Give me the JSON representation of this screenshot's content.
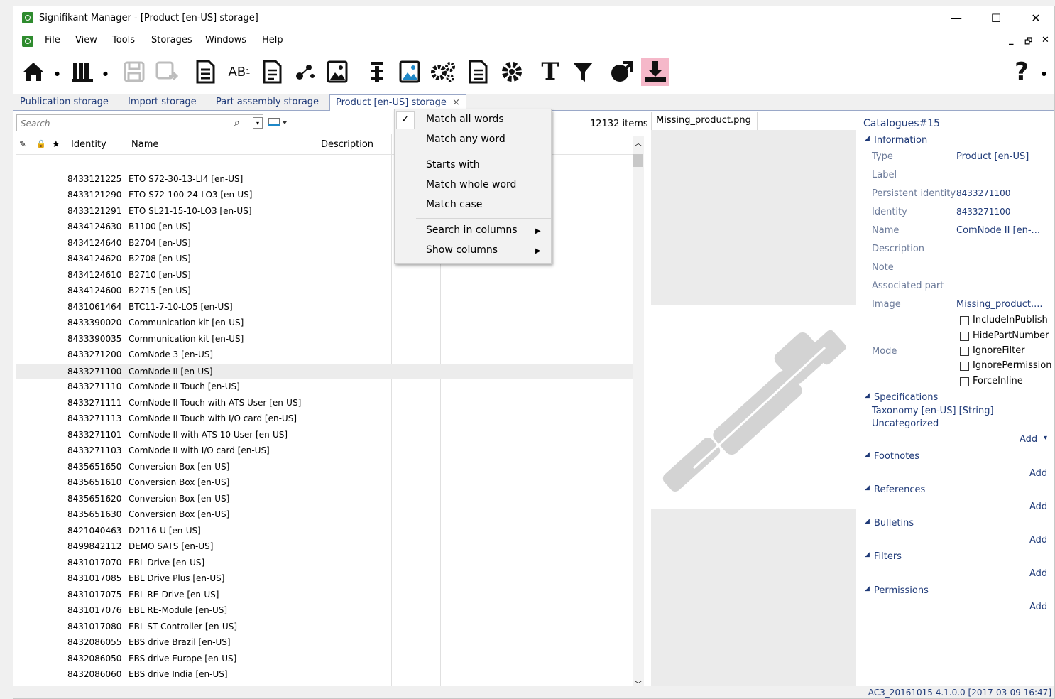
{
  "window": {
    "title": "Signifikant Manager - [Product [en-US] storage]",
    "controls": {
      "minimize": "—",
      "maximize": "☐",
      "close": "✕"
    }
  },
  "menubar": {
    "items": [
      "File",
      "View",
      "Tools",
      "Storages",
      "Windows",
      "Help"
    ],
    "right_glyphs": [
      "_",
      "🗗",
      "✕"
    ]
  },
  "toolbar": {
    "icons": [
      "home-icon",
      "library-icon",
      "save-icon",
      "save-as-icon",
      "document-list-icon",
      "spellcheck-icon",
      "document-text-icon",
      "share-nodes-icon",
      "image-icon",
      "text-align-icon",
      "image-edit-icon",
      "settings-gears-icon",
      "document-icon",
      "gear-icon",
      "text-type-icon",
      "filter-icon",
      "globe-arrow-icon",
      "download-icon",
      "help-icon"
    ],
    "help_label": "?"
  },
  "tabs": [
    {
      "label": "Publication storage"
    },
    {
      "label": "Import storage"
    },
    {
      "label": "Part assembly storage"
    },
    {
      "label": "Product [en-US] storage",
      "close": "×"
    }
  ],
  "search": {
    "placeholder": "Search",
    "icon": "⌕",
    "dropdown": "▾"
  },
  "list": {
    "item_count": "12132 items",
    "columns": {
      "identity": "Identity",
      "name": "Name",
      "description": "Description"
    },
    "header_icons": [
      "pencil-icon",
      "lock-icon",
      "star-icon"
    ],
    "rows": [
      {
        "id": "",
        "name": ""
      },
      {
        "id": "8433121225",
        "name": "ETO S72-30-13-LI4 [en-US]"
      },
      {
        "id": "8433121290",
        "name": "ETO S72-100-24-LO3 [en-US]"
      },
      {
        "id": "8433121291",
        "name": "ETO SL21-15-10-LO3 [en-US]"
      },
      {
        "id": "8434124630",
        "name": "B1100 [en-US]"
      },
      {
        "id": "8434124640",
        "name": "B2704 [en-US]"
      },
      {
        "id": "8434124620",
        "name": "B2708 [en-US]"
      },
      {
        "id": "8434124610",
        "name": "B2710 [en-US]"
      },
      {
        "id": "8434124600",
        "name": "B2715 [en-US]"
      },
      {
        "id": "8431061464",
        "name": "BTC11-7-10-LO5 [en-US]"
      },
      {
        "id": "8433390020",
        "name": "Communication kit [en-US]"
      },
      {
        "id": "8433390035",
        "name": "Communication kit [en-US]"
      },
      {
        "id": "8433271200",
        "name": "ComNode 3 [en-US]"
      },
      {
        "id": "8433271100",
        "name": "ComNode II [en-US]",
        "selected": true
      },
      {
        "id": "8433271110",
        "name": "ComNode II Touch [en-US]"
      },
      {
        "id": "8433271111",
        "name": "ComNode II Touch with ATS User [en-US]"
      },
      {
        "id": "8433271113",
        "name": "ComNode II Touch with I/O card [en-US]"
      },
      {
        "id": "8433271101",
        "name": "ComNode II with ATS 10 User [en-US]"
      },
      {
        "id": "8433271103",
        "name": "ComNode II with I/O card [en-US]"
      },
      {
        "id": "8435651650",
        "name": "Conversion Box [en-US]"
      },
      {
        "id": "8435651610",
        "name": "Conversion Box [en-US]"
      },
      {
        "id": "8435651620",
        "name": "Conversion Box [en-US]"
      },
      {
        "id": "8435651630",
        "name": "Conversion Box [en-US]"
      },
      {
        "id": "8421040463",
        "name": "D2116-U [en-US]"
      },
      {
        "id": "8499842112",
        "name": "DEMO SATS [en-US]"
      },
      {
        "id": "8431017070",
        "name": "EBL Drive [en-US]"
      },
      {
        "id": "8431017085",
        "name": "EBL Drive Plus [en-US]"
      },
      {
        "id": "8431017075",
        "name": "EBL RE-Drive [en-US]"
      },
      {
        "id": "8431017076",
        "name": "EBL RE-Module [en-US]"
      },
      {
        "id": "8431017080",
        "name": "EBL ST Controller [en-US]"
      },
      {
        "id": "8432086055",
        "name": "EBS drive Brazil [en-US]"
      },
      {
        "id": "8432086050",
        "name": "EBS drive Europe [en-US]"
      },
      {
        "id": "8432086060",
        "name": "EBS drive India [en-US]"
      }
    ]
  },
  "search_menu": {
    "items": [
      "Match all words",
      "Match any word",
      "Starts with",
      "Match whole word",
      "Match case",
      "Search in columns",
      "Show columns"
    ],
    "checked": "Match all words",
    "check_glyph": "✓",
    "submenu_glyph": "▶"
  },
  "image_pane": {
    "tab_label": "Missing_product.png"
  },
  "properties": {
    "header": "Catalogues#15",
    "sections": {
      "information": "Information",
      "specifications": "Specifications",
      "footnotes": "Footnotes",
      "references": "References",
      "bulletins": "Bulletins",
      "filters": "Filters",
      "permissions": "Permissions"
    },
    "fields": {
      "type_label": "Type",
      "type_value": "Product [en-US]",
      "label_label": "Label",
      "persistent_label": "Persistent identity",
      "persistent_value": "8433271100",
      "identity_label": "Identity",
      "identity_value": "8433271100",
      "name_label": "Name",
      "name_value": "ComNode II [en-...",
      "description_label": "Description",
      "note_label": "Note",
      "associated_label": "Associated part",
      "image_label": "Image",
      "image_value": "Missing_product....",
      "mode_label": "Mode"
    },
    "mode_flags": [
      "IncludeInPublish",
      "HidePartNumber",
      "IgnoreFilter",
      "IgnorePermission",
      "ForceInline"
    ],
    "taxonomy_line1": "Taxonomy [en-US] [String]",
    "taxonomy_line2": "Uncategorized",
    "add_label": "Add",
    "add_dropdown": "▾",
    "collapse_glyph": "◢"
  },
  "status": {
    "text": "AC3_20161015  4.1.0.0 [2017-03-09 16:47]"
  },
  "colors": {
    "accent": "#1f3a78",
    "highlight": "#f5b8c9",
    "app_green": "#2e8b2e"
  }
}
